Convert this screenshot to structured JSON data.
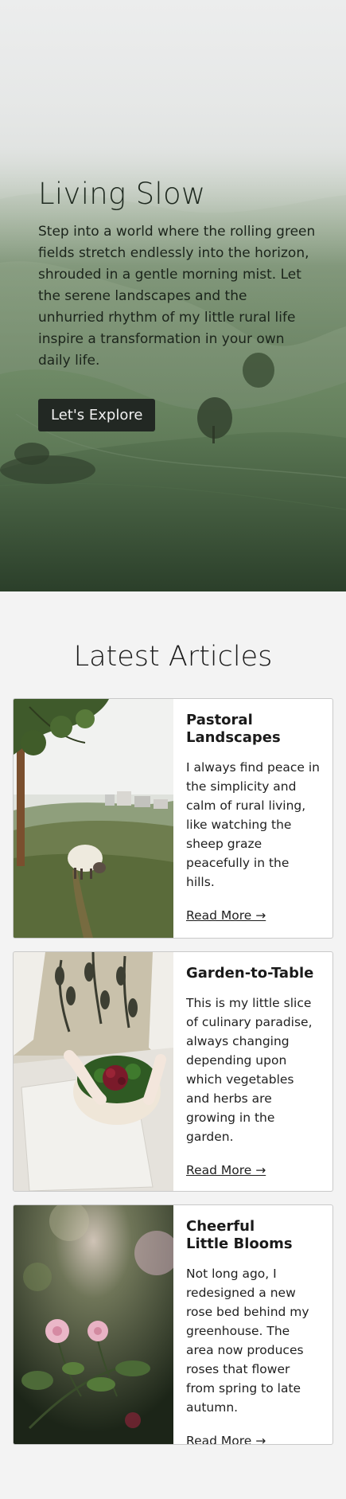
{
  "hero": {
    "title": "Living Slow",
    "text": "Step into a world where the rolling green fields stretch endlessly into the horizon, shrouded in a gentle morning mist. Let the serene landscapes and the unhurried rhythm of my little rural life inspire a transformation in your own daily life.",
    "button_label": "Let's Explore"
  },
  "articles": {
    "section_title": "Latest Articles",
    "items": [
      {
        "title": "Pastoral\nLandscapes",
        "text": "I always find peace in the simplicity and calm of rural living, like watching the sheep graze peacefully in the hills.",
        "link_label": "Read More →",
        "image": "sheep-grazing-photo"
      },
      {
        "title": "Garden-to-Table",
        "text": "This is my little slice of culinary paradise, always changing depending upon which vegetables and herbs are growing in the garden.",
        "link_label": "Read More →",
        "image": "salad-bowl-photo"
      },
      {
        "title": "Cheerful\nLittle Blooms",
        "text": "Not long ago, I redesigned a new rose bed behind my greenhouse. The area now produces roses that flower from spring to late autumn.",
        "link_label": "Read More →",
        "image": "pink-roses-photo"
      }
    ]
  },
  "colors": {
    "page_background": "#f3f3f3",
    "button_background": "#222823",
    "card_background": "#ffffff"
  }
}
